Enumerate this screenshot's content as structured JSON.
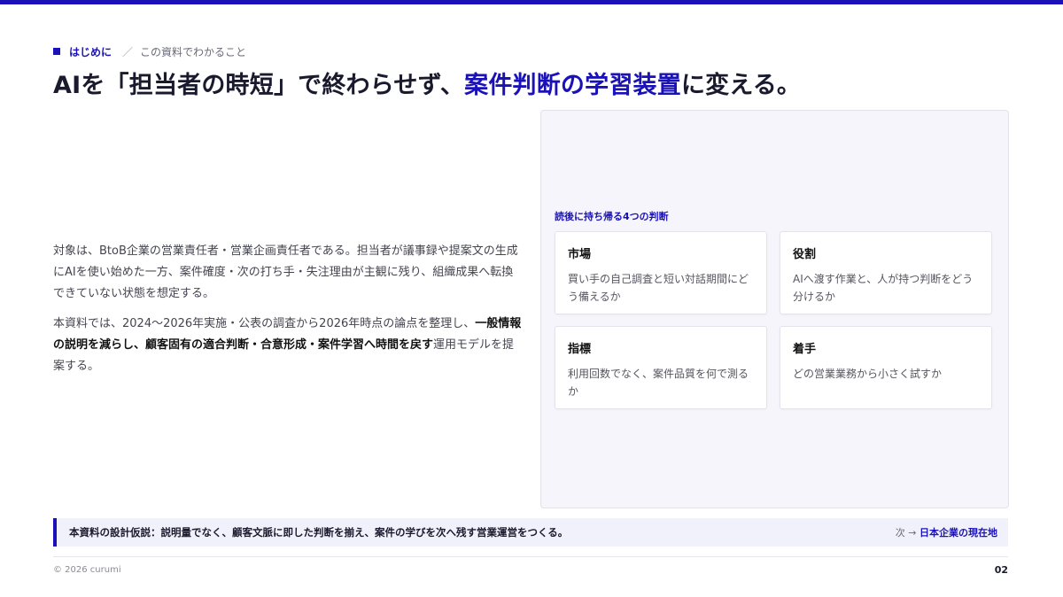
{
  "eyebrow": {
    "section": "はじめに",
    "separator": "／",
    "subtitle": "この資料でわかること"
  },
  "headline": {
    "part1": "AIを「担当者の時短」で終わらせず、",
    "accent": "案件判断の学習装置",
    "part2": "に変える。"
  },
  "body": {
    "paragraph1": "対象は、BtoB企業の営業責任者・営業企画責任者である。担当者が議事録や提案文の生成にAIを使い始めた一方、案件確度・次の打ち手・失注理由が主観に残り、組織成果へ転換できていない状態を想定する。",
    "paragraph2_prefix": "本資料では、2024〜2026年実施・公表の調査から2026年時点の論点を整理し、",
    "paragraph2_bold": "一般情報の説明を減らし、顧客固有の適合判断・合意形成・案件学習へ時間を戻す",
    "paragraph2_suffix": "運用モデルを提案する。"
  },
  "panel": {
    "label": "読後に持ち帰る4つの判断",
    "cards": [
      {
        "title": "市場",
        "desc": "買い手の自己調査と短い対話期間にどう備えるか"
      },
      {
        "title": "役割",
        "desc": "AIへ渡す作業と、人が持つ判断をどう分けるか"
      },
      {
        "title": "指標",
        "desc": "利用回数でなく、案件品質を何で測るか"
      },
      {
        "title": "着手",
        "desc": "どの営業業務から小さく試すか"
      }
    ]
  },
  "footer": {
    "thesis": "本資料の設計仮説：説明量でなく、顧客文脈に即した判断を揃え、案件の学びを次へ残す営業運営をつくる。",
    "next_prefix": "次 →",
    "next_link": "日本企業の現在地",
    "copyright": "© 2026 curumi",
    "page": "02"
  },
  "colors": {
    "accent": "#1a12b8",
    "panel_bg": "#f6f5fb",
    "footer_bg": "#f1f1fb"
  }
}
